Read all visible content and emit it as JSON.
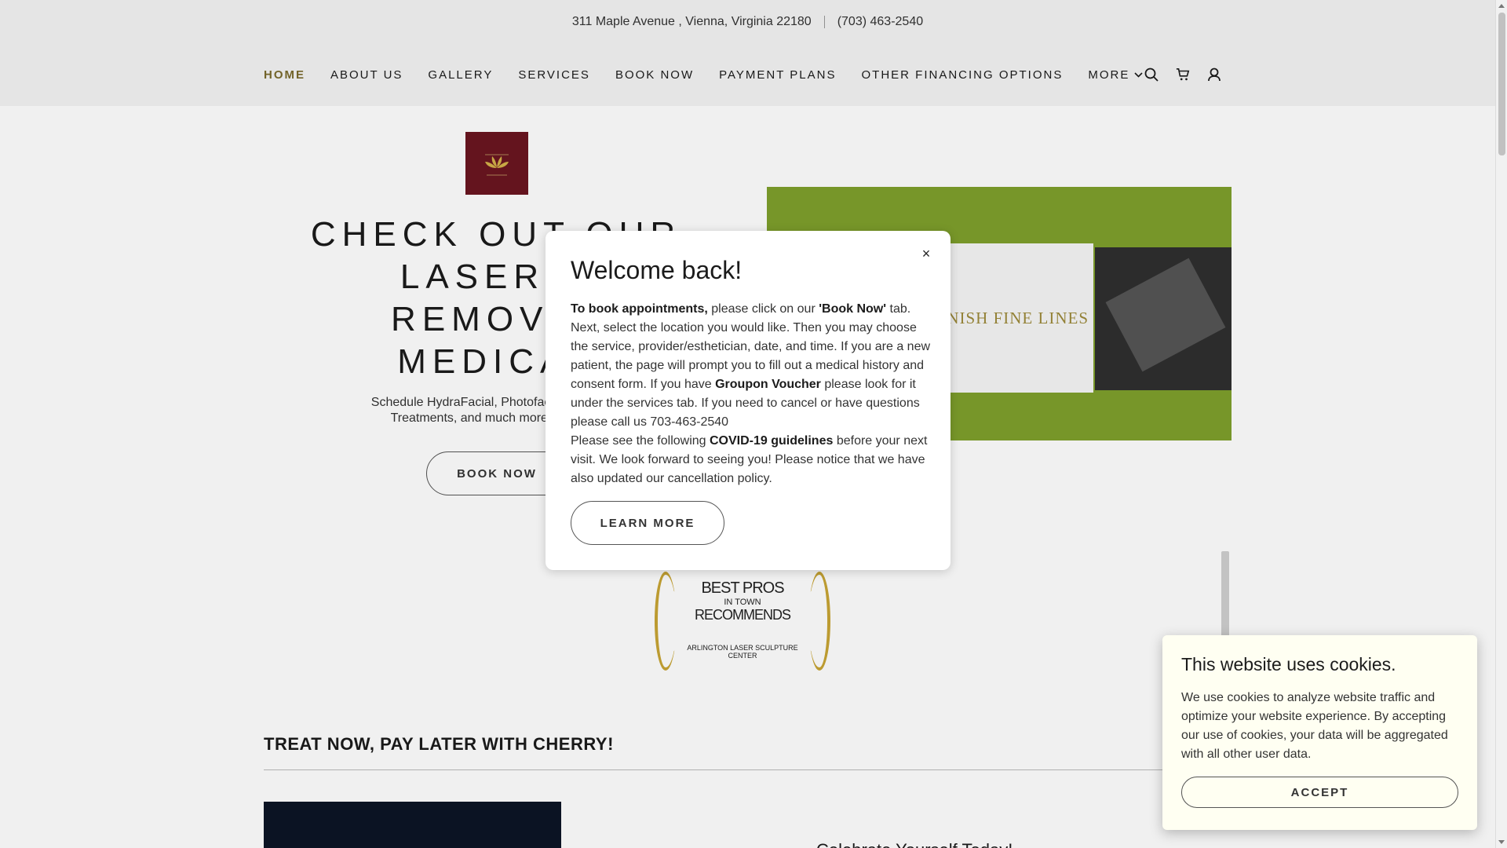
{
  "topbar": {
    "address": "311 Maple Avenue , Vienna, Virginia 22180",
    "phone": "(703) 463-2540"
  },
  "nav": {
    "items": [
      {
        "label": "HOME"
      },
      {
        "label": "ABOUT US"
      },
      {
        "label": "GALLERY"
      },
      {
        "label": "SERVICES"
      },
      {
        "label": "BOOK NOW"
      },
      {
        "label": "PAYMENT PLANS"
      },
      {
        "label": "OTHER FINANCING OPTIONS"
      },
      {
        "label": "MORE"
      }
    ],
    "icons": [
      "search-icon",
      "cart-icon",
      "account-icon"
    ]
  },
  "hero": {
    "title": "CHECK OUT OUR LASER H REMOVAL MEDICAL",
    "title_lines": [
      "CHECK OUT OUR",
      "LASER H",
      "REMOVAL",
      "MEDICAL"
    ],
    "subtitle_lines": [
      "Schedule HydraFacial, Photofacial, Laser Ha",
      "Treatments, and much more here at A"
    ],
    "book_label": "BOOK NOW"
  },
  "promo": {
    "text": "INISH FINE LINES"
  },
  "badge": {
    "line1": "BEST PROS",
    "line2": "IN TOWN",
    "line3": "RECOMMENDS",
    "line4": "ARLINGTON LASER SCULPTURE CENTER"
  },
  "section": {
    "title": "TREAT NOW, PAY LATER WITH CHERRY!",
    "cta": "Celebrate Yourself Today!"
  },
  "modal": {
    "title": "Welcome back!",
    "p1_bold": "To book appointments,",
    "p1_a": " please click on our ",
    "p1_bold2": "'Book Now'",
    "p1_b": " tab. Next, select the location you would like. Then you may choose the service, provider/esthetician, date, and time. If you are a new patient, the page will prompt you to fill out a medical history and consent form.  If you have ",
    "p1_bold3": "Groupon Voucher",
    "p1_c": " please look for it under the services tab. If you need to cancel or have questions please call us 703-463-2540",
    "p2_a": "Please see the following ",
    "p2_bold": "COVID-19 guidelines",
    "p2_b": " before your next visit. We look forward to seeing you! Please notice that we have also updated our cancellation policy.",
    "button": "LEARN MORE",
    "close": "×"
  },
  "cookie": {
    "title": "This website uses cookies.",
    "text": "We use cookies to analyze website traffic and optimize your website experience. By accepting our use of cookies, your data will be aggregated with all other user data.",
    "accept": "ACCEPT"
  },
  "colors": {
    "accent": "#7a6a2c",
    "promo_green": "#7fa02c",
    "logo_bg": "#6b1620"
  }
}
